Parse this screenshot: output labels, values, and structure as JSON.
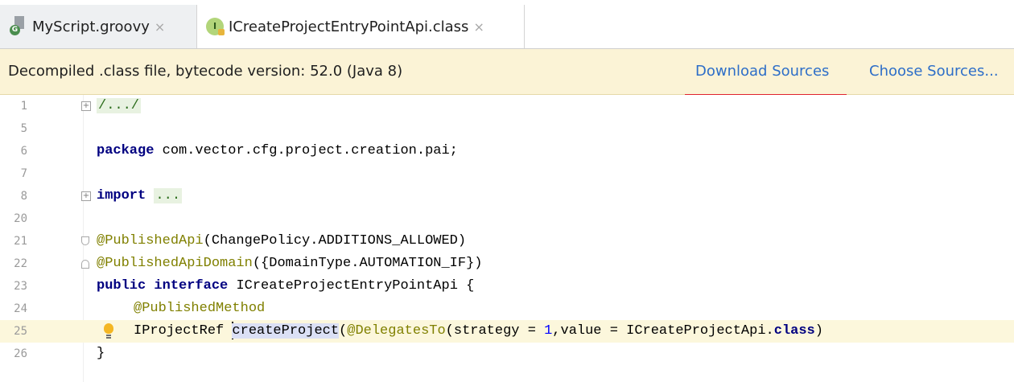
{
  "tabs": [
    {
      "label": "MyScript.groovy",
      "icon": "groovy-file-icon",
      "active": false
    },
    {
      "label": "ICreateProjectEntryPointApi.class",
      "icon": "interface-class-icon",
      "active": true
    }
  ],
  "tab_close_glyph": "×",
  "banner": {
    "text": "Decompiled .class file, bytecode version: 52.0 (Java 8)",
    "download_label": "Download Sources",
    "choose_label": "Choose Sources...",
    "highlight_color": "#e0242e"
  },
  "code": {
    "line_numbers": [
      "1",
      "5",
      "6",
      "7",
      "8",
      "20",
      "21",
      "22",
      "23",
      "24",
      "25",
      "26"
    ],
    "header_fold": "/.../",
    "package_kw": "package",
    "package_name": " com.vector.cfg.project.creation.pai;",
    "import_kw": "import",
    "import_fold": "...",
    "ann1": "@PublishedApi",
    "ann1_args": "(ChangePolicy.ADDITIONS_ALLOWED)",
    "ann2": "@PublishedApiDomain",
    "ann2_args": "({DomainType.AUTOMATION_IF})",
    "public_kw": "public",
    "interface_kw": "interface",
    "interface_name": " ICreateProjectEntryPointApi {",
    "ann3": "@PublishedMethod",
    "return_type": "IProjectRef ",
    "method_name": "createProject",
    "open_paren": "(",
    "ann4": "@DelegatesTo",
    "args_a": "(strategy = ",
    "args_num": "1",
    "args_b": ",value = ICreateProjectApi.",
    "class_kw": "class",
    "args_c": ")",
    "close_brace": "}"
  }
}
